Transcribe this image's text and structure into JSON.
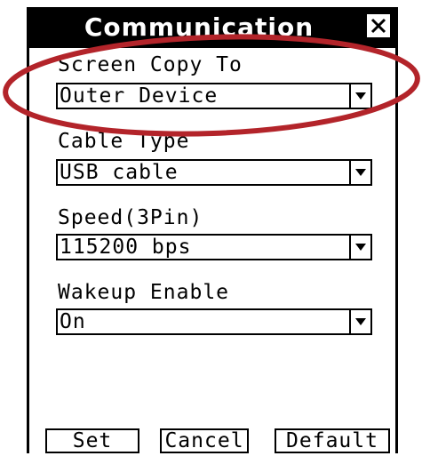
{
  "dialog": {
    "title": "Communication",
    "close_label": "X"
  },
  "fields": [
    {
      "label": "Screen Copy To",
      "value": "Outer Device"
    },
    {
      "label": "Cable Type",
      "value": "USB cable"
    },
    {
      "label": "Speed(3Pin)",
      "value": "115200 bps"
    },
    {
      "label": "Wakeup Enable",
      "value": "On"
    }
  ],
  "buttons": {
    "set": "Set",
    "cancel": "Cancel",
    "default": "Default"
  },
  "colors": {
    "titlebar": "#000000",
    "background": "#ffffff",
    "annotation": "#b3242a"
  },
  "icons": {
    "close": "close-icon",
    "dropdown": "dropdown-arrow-icon"
  }
}
